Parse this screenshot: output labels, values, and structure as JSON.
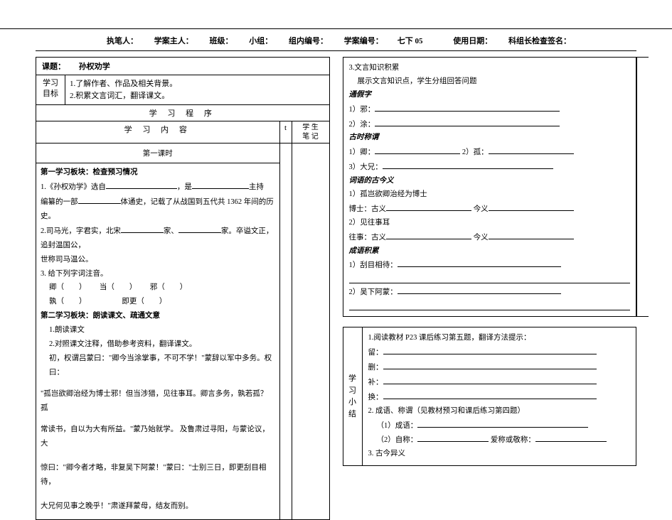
{
  "header": {
    "author": "执笔人：",
    "owner": "学案主人：",
    "class": "班级：",
    "group": "小组：",
    "group_no": "组内编号：",
    "plan_no_label": "学案编号：",
    "plan_no_value": "七下 05",
    "use_date": "使用日期：",
    "leader_sign": "科组长检查签名："
  },
  "left": {
    "topic_label": "课题：",
    "topic_title": "孙权劝学",
    "goal_label1": "学习",
    "goal_label2": "目标",
    "goal_1": "1.了解作者、作品及相关背景。",
    "goal_2": "2.积累文言词汇，翻译课文。",
    "procedure": "学 习 程 序",
    "subhead_content": "学 习 内 容",
    "subhead_t": "t",
    "subhead_notes": "学 生\n笔 记",
    "lesson": "第一课时",
    "block1_title": "第一学习板块：检查预习情况",
    "p1a": "1.《孙权劝学》选自",
    "p1b": "，是",
    "p1c": "主持",
    "p2a": "编纂的一部",
    "p2b": "体通史，记载了从战国到五代共 1362 年间的历史。",
    "p3a": "2.司马光，字君实，北宋",
    "p3b": "家、",
    "p3c": "家。卒谥文正，追封温国公，",
    "p4": "世称司马温公。",
    "p5": "3. 给下列字词注音。",
    "p6a": "卿（　　）",
    "p6b": "当（　　）",
    "p6c": "邪（　　）",
    "p7a": "孰（　　）",
    "p7b": "即更（　　）",
    "block2_title": "第二学习板块：朗读课文、疏通文意",
    "p8": "1.朗读课文",
    "p9": "2.对照课文注释，借助参考资料，翻译课文。",
    "p10": "初，权谓吕蒙曰：\"卿今当涂掌事，不可不学！\"蒙辞以军中多务。权曰：",
    "p11": "\"孤岂欲卿治经为博士邪！但当涉猎，见往事耳。卿言多务，孰若孤？孤",
    "p12": "常读书，自以为大有所益。\"蒙乃始就学。 及鲁肃过寻阳，与蒙论议，大",
    "p13": "惊曰：\"卿今者才略，非复吴下阿蒙！\"蒙曰：\"士别三日，即更刮目相待，",
    "p14": "大兄何见事之晚乎！\"肃遂拜蒙母，结友而别。"
  },
  "right_top": {
    "r1": "3.文言知识积累",
    "r2": "展示文言知识点，学生分组回答问题",
    "h1": "通假字",
    "r3": "1）邪：",
    "r4": "2）涂：",
    "h2": "古时称谓",
    "r5a": "1）卿：",
    "r5b": "2）孤：",
    "r6": "3）大兄：",
    "h3": "词语的古今义",
    "r7": "1）孤岂欲卿治经为博士",
    "r8a": "博士：古义",
    "r8b": "今义",
    "r9": "2）见往事耳",
    "r10a": "往事：古义",
    "r10b": "今义",
    "h4": "成语积累",
    "r11": "1）刮目相待：",
    "r12": "2）吴下阿蒙："
  },
  "right_bottom": {
    "label1": "学",
    "label2": "习",
    "label3": "小",
    "label4": "结",
    "s1": "1.阅读教材 P23 课后练习第五题，翻译方法提示：",
    "s2": "留：",
    "s3": "删：",
    "s4": "补：",
    "s5": "换：",
    "s6": "2. 成语、称谓（见教材预习和课后练习第四题）",
    "s7": "（1）成语：",
    "s8a": "（2）自称：",
    "s8b": "爱称或敬称：",
    "s9": "3.  古今异义"
  }
}
